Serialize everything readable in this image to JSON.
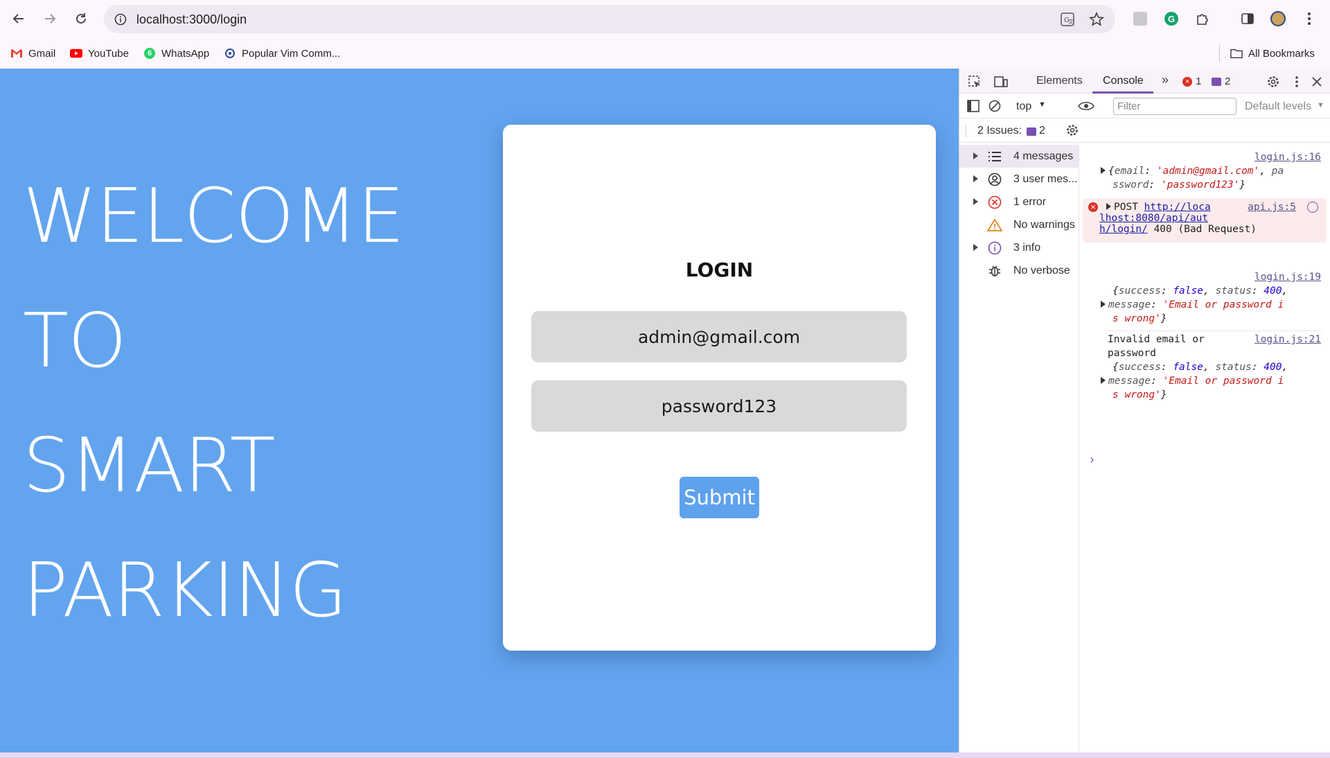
{
  "browser": {
    "url": "localhost:3000/login",
    "bookmarks": [
      {
        "label": "Gmail",
        "icon": "gmail-icon"
      },
      {
        "label": "YouTube",
        "icon": "youtube-icon"
      },
      {
        "label": "WhatsApp",
        "icon": "whatsapp-icon"
      },
      {
        "label": "Popular Vim Comm...",
        "icon": "vim-icon"
      }
    ],
    "all_bookmarks": "All Bookmarks"
  },
  "page": {
    "welcome_lines": [
      "WELCOME",
      "TO",
      "SMART",
      "PARKING"
    ],
    "login": {
      "title": "LOGIN",
      "email_value": "admin@gmail.com",
      "password_value": "password123",
      "submit_label": "Submit"
    },
    "colors": {
      "background": "#63a4ef",
      "button": "#5ea2ee",
      "field": "#d9d9d9"
    }
  },
  "devtools": {
    "tabs": {
      "elements": "Elements",
      "console": "Console"
    },
    "error_count": "1",
    "issue_count": "2",
    "context": "top",
    "filter_placeholder": "Filter",
    "levels": "Default levels",
    "issues_label": "2 Issues:",
    "issues_count": "2",
    "sidebar": [
      {
        "label": "4 messages",
        "icon": "list-icon"
      },
      {
        "label": "3 user mes...",
        "icon": "user-icon"
      },
      {
        "label": "1 error",
        "icon": "error-icon"
      },
      {
        "label": "No warnings",
        "icon": "warning-icon"
      },
      {
        "label": "3 info",
        "icon": "info-icon"
      },
      {
        "label": "No verbose",
        "icon": "bug-icon"
      }
    ],
    "messages": {
      "m1_src": "login.js:16",
      "m1_email_key": "email",
      "m1_email_val": "'admin@gmail.com'",
      "m1_pass_key_a": "pa",
      "m1_pass_key_b": "ssword",
      "m1_pass_val": "'password123'",
      "m2_method": "POST",
      "m2_url_a": "http://loca",
      "m2_url_b": "lhost:8080/api/aut",
      "m2_url_c": "h/login/",
      "m2_status": "400 (Bad Request)",
      "m2_src": "api.js:5",
      "m3_src": "login.js:19",
      "m3_success": "false",
      "m3_status": "400",
      "m3_msg_a": "'Email or password i",
      "m3_msg_b": "s wrong'",
      "m4_text_a": "Invalid email or",
      "m4_text_b": "password",
      "m4_src": "login.js:21",
      "m4_success": "false",
      "m4_status": "400",
      "m4_msg_a": "'Email or password i",
      "m4_msg_b": "s wrong'",
      "prompt": "›"
    }
  }
}
